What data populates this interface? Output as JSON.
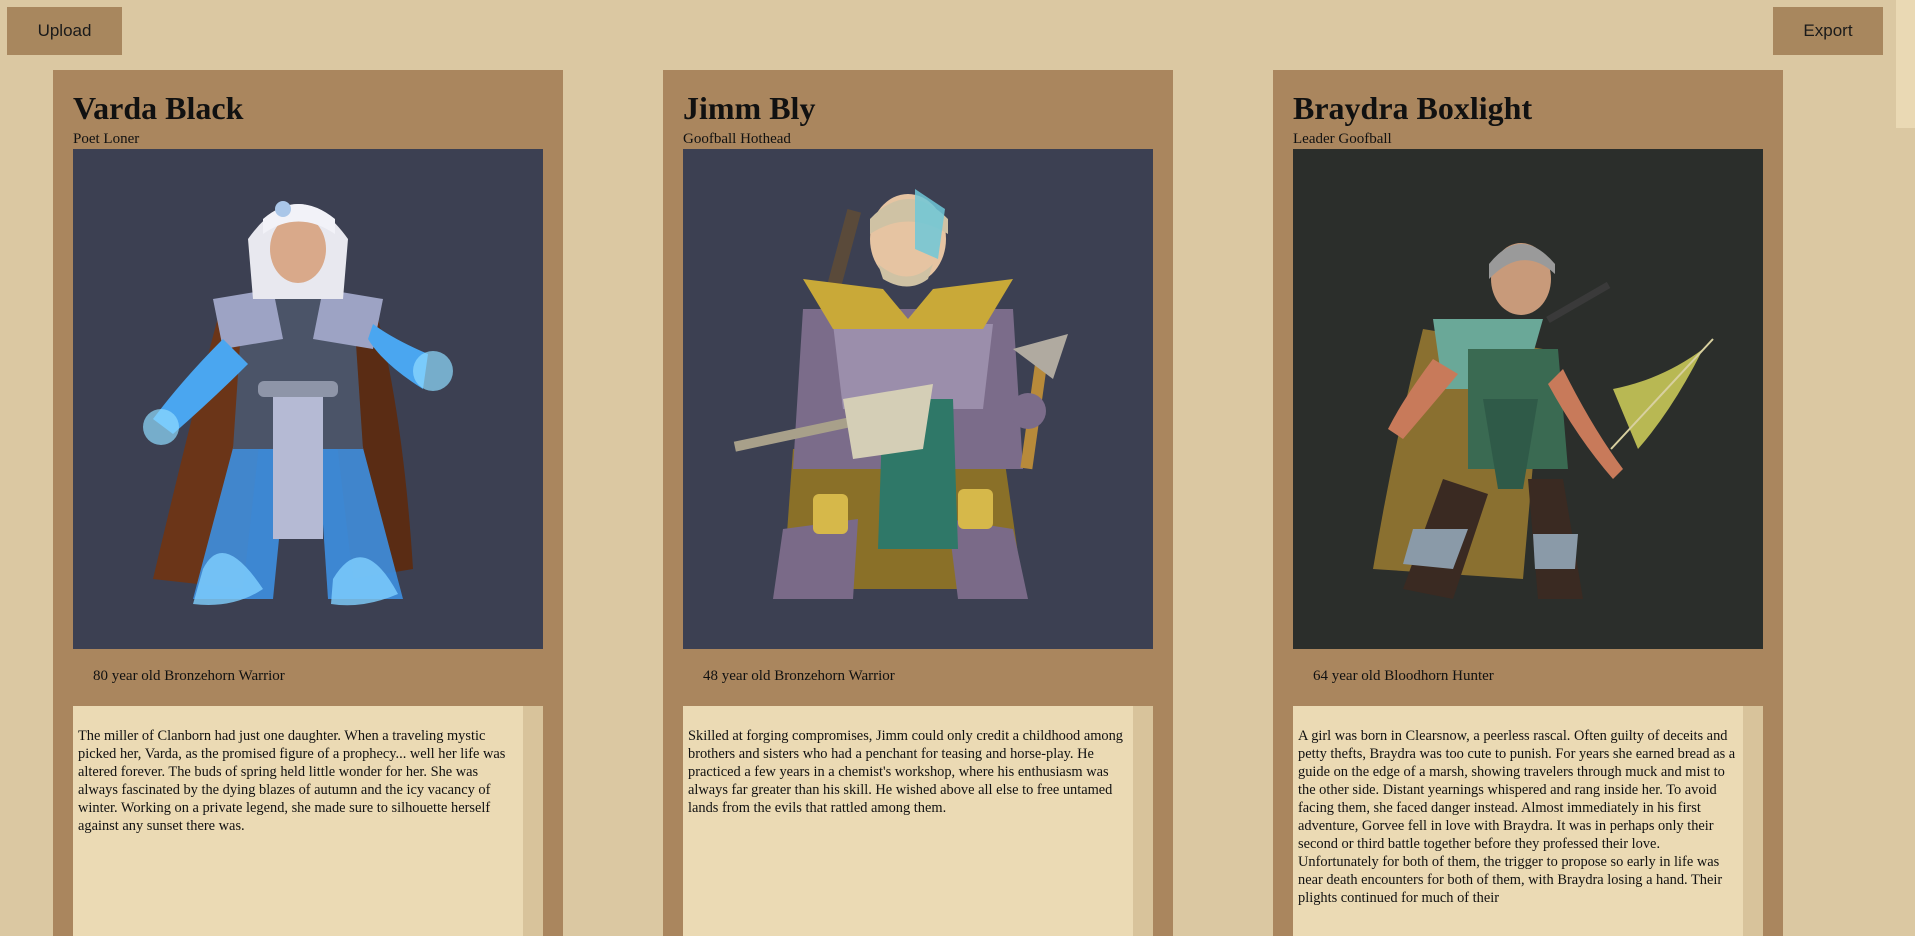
{
  "toolbar": {
    "upload_label": "Upload",
    "export_label": "Export"
  },
  "colors": {
    "background": "#dbc8a2",
    "card": "#aa865e",
    "button": "#a8875e",
    "bio_panel": "#ebdab4"
  },
  "cards": [
    {
      "name": "Varda Black",
      "traits": "Poet Loner",
      "portrait_bg": "#3c4052",
      "portrait_icon": "elf-mage-portrait",
      "age_line": "80 year old Bronzehorn Warrior",
      "bio": "The miller of Clanborn had just one daughter. When a traveling mystic picked her, Varda, as the promised figure of a prophecy... well her life was altered forever. The buds of spring held little wonder for her. She was always fascinated by the dying blazes of autumn and the icy vacancy of winter. Working on a private legend, she made sure to silhouette herself against any sunset there was."
    },
    {
      "name": "Jimm Bly",
      "traits": "Goofball Hothead",
      "portrait_bg": "#3c4052",
      "portrait_icon": "armored-warrior-portrait",
      "age_line": "48 year old Bronzehorn Warrior",
      "bio": "Skilled at forging compromises, Jimm could only credit a childhood among brothers and sisters who had a penchant for teasing and horse-play. He practiced a few years in a chemist's workshop, where his enthusiasm was always far greater than his skill. He wished above all else to free untamed lands from the evils that rattled among them."
    },
    {
      "name": "Braydra Boxlight",
      "traits": "Leader Goofball",
      "portrait_bg": "#2b2e2b",
      "portrait_icon": "ranger-archer-portrait",
      "age_line": "64 year old Bloodhorn Hunter",
      "bio": "A girl was born in Clearsnow, a peerless rascal. Often guilty of deceits and petty thefts, Braydra was too cute to punish. For years she earned bread as a guide on the edge of a marsh, showing travelers through muck and mist to the other side. Distant yearnings whispered and rang inside her. To avoid facing them, she faced danger instead. Almost immediately in his first adventure, Gorvee fell in love with Braydra. It was in perhaps only their second or third battle together before they professed their love. Unfortunately for both of them, the trigger to propose so early in life was near death encounters for both of them, with Braydra losing a hand. Their plights continued for much of their"
    }
  ]
}
